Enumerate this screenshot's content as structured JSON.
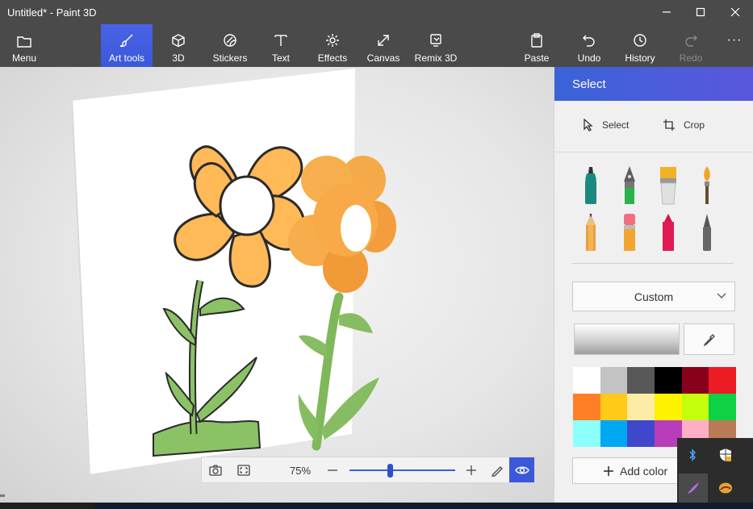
{
  "window": {
    "title": "Untitled* - Paint 3D"
  },
  "ribbon": {
    "left_tools": [
      {
        "label": "Menu",
        "icon": "folder-icon"
      },
      {
        "label": "Art tools",
        "icon": "brush-icon",
        "active": true
      },
      {
        "label": "3D",
        "icon": "cube-icon"
      },
      {
        "label": "Stickers",
        "icon": "sticker-icon"
      },
      {
        "label": "Text",
        "icon": "text-icon"
      },
      {
        "label": "Effects",
        "icon": "sun-icon"
      },
      {
        "label": "Canvas",
        "icon": "resize-icon"
      },
      {
        "label": "Remix 3D",
        "icon": "remix-icon"
      }
    ],
    "right_tools": [
      {
        "label": "Paste",
        "icon": "clipboard-icon"
      },
      {
        "label": "Undo",
        "icon": "undo-icon"
      },
      {
        "label": "History",
        "icon": "history-icon"
      },
      {
        "label": "Redo",
        "icon": "redo-icon",
        "disabled": true
      }
    ],
    "more_label": "···"
  },
  "zoom": {
    "percent_label": "75%",
    "level_fraction": 0.38
  },
  "panel": {
    "title": "Select",
    "select_label": "Select",
    "crop_label": "Crop",
    "brush_type": "Custom",
    "add_color_label": "Add color",
    "palette": [
      "#ffffff",
      "#c3c3c3",
      "#585858",
      "#000000",
      "#88001b",
      "#ec1c24",
      "#ff7f27",
      "#ffca18",
      "#fdeca6",
      "#fff200",
      "#c4ff0e",
      "#0ed145",
      "#8cfffb",
      "#00a8f3",
      "#3f48cc",
      "#b83dba",
      "#ffaec8",
      "#b97a56"
    ]
  },
  "colors": {
    "accent": "#3a58d9",
    "flower_petal": "#ffb957",
    "stem": "#8bc266"
  }
}
